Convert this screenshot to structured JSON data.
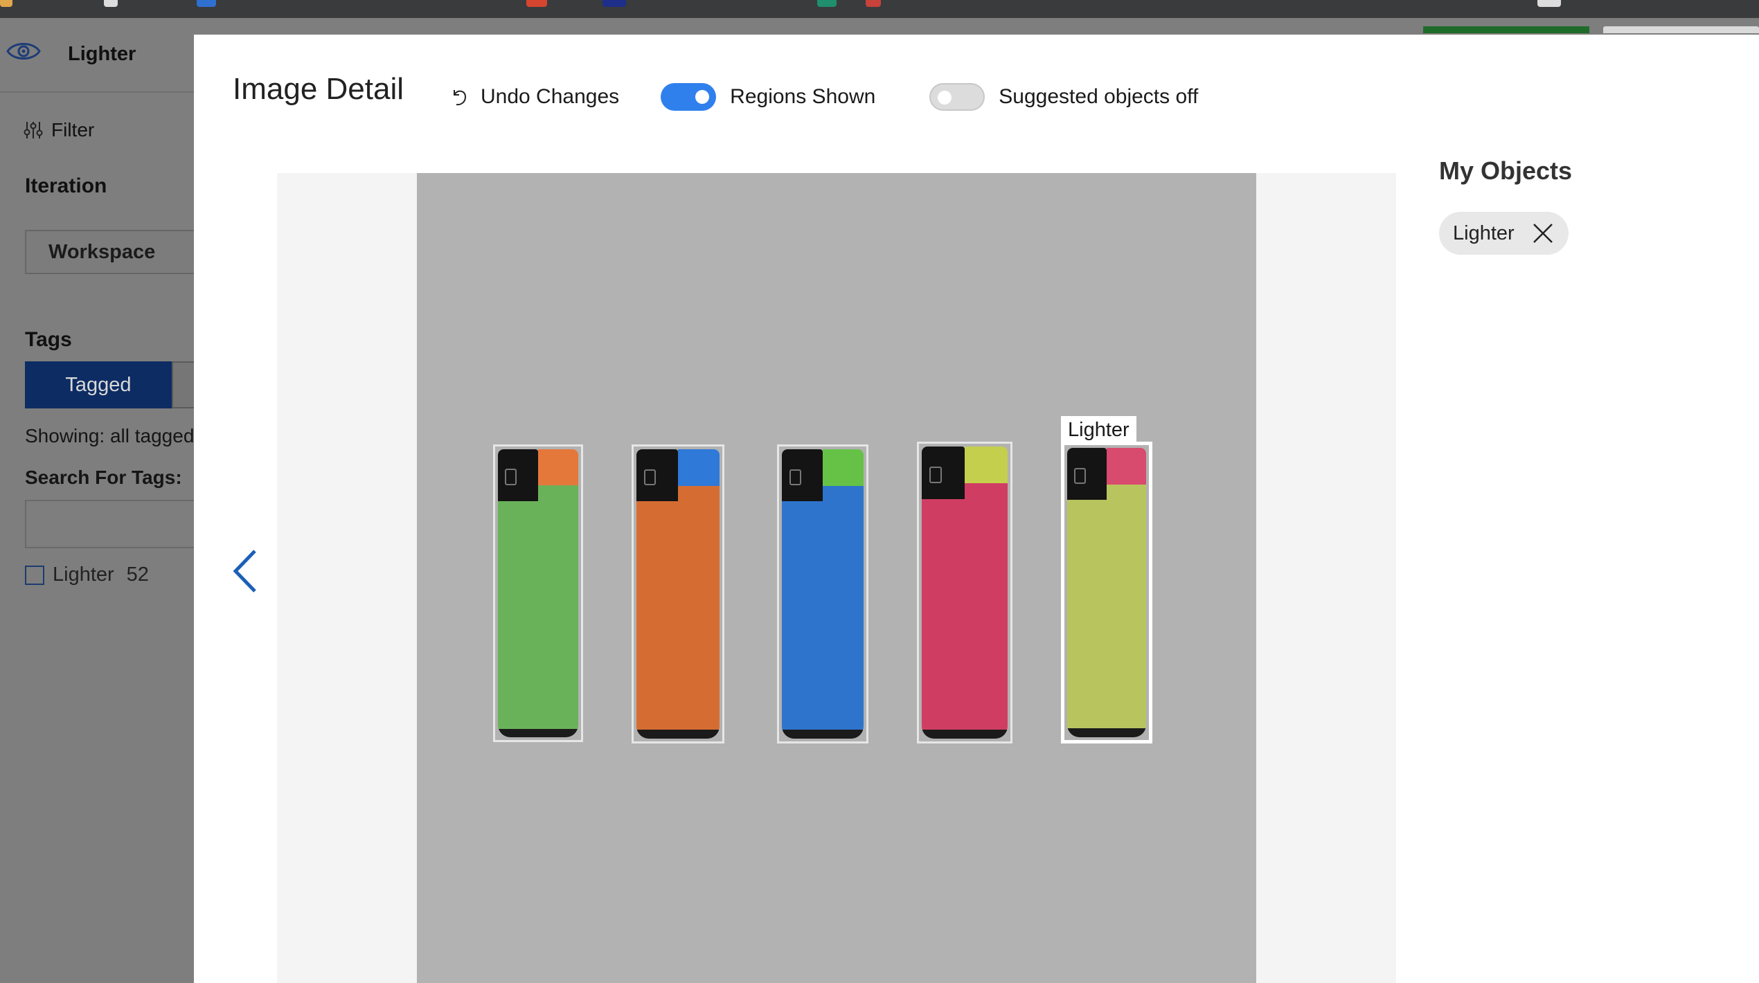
{
  "app": {
    "project_name": "Lighter",
    "project_icon": "eye-icon"
  },
  "sidebar": {
    "filter_label": "Filter",
    "iteration_heading": "Iteration",
    "iteration_value": "Workspace",
    "tags_heading": "Tags",
    "tabs": [
      {
        "label": "Tagged",
        "active": true
      }
    ],
    "showing_text": "Showing: all tagged",
    "search_label": "Search For Tags:",
    "search_value": "",
    "tags": [
      {
        "label": "Lighter",
        "count": "52",
        "checked": false
      }
    ]
  },
  "modal": {
    "title": "Image Detail",
    "undo_label": "Undo Changes",
    "regions_toggle": {
      "label": "Regions Shown",
      "on": true
    },
    "suggested_toggle": {
      "label": "Suggested objects off",
      "on": false
    },
    "prev_icon": "chevron-left-icon",
    "regions": [
      {
        "tag": "",
        "color": "#6ab25a",
        "button_color": "#e4773a",
        "selected": false
      },
      {
        "tag": "",
        "color": "#d56d33",
        "button_color": "#2f79d8",
        "selected": false
      },
      {
        "tag": "",
        "color": "#2e74cc",
        "button_color": "#66c246",
        "selected": false
      },
      {
        "tag": "",
        "color": "#d03d63",
        "button_color": "#c4cf4e",
        "selected": false
      },
      {
        "tag": "Lighter",
        "color": "#b8c55e",
        "button_color": "#d84a6e",
        "selected": true
      }
    ],
    "my_objects_heading": "My Objects",
    "objects": [
      {
        "label": "Lighter",
        "remove_icon": "close-icon"
      }
    ]
  },
  "colors": {
    "accent": "#2f80ed",
    "tab_active": "#0d2c63",
    "overlay_bg": "#7e7e7e",
    "photo_bg": "#b2b2b2"
  }
}
